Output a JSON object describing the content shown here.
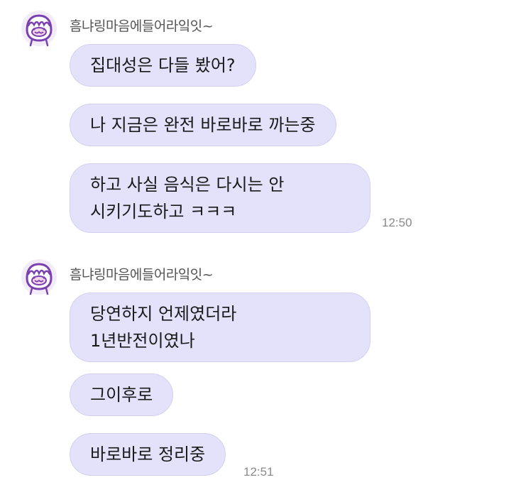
{
  "chat": {
    "groups": [
      {
        "sender": "흠냐링마음에들어라잌잇~",
        "messages": [
          {
            "lines": [
              "집대성은 다들 봤어?"
            ]
          },
          {
            "lines": [
              "나 지금은 완전 바로바로 까는중"
            ]
          },
          {
            "lines": [
              "하고 사실 음식은 다시는 안",
              "시키기도하고 ㅋㅋㅋ"
            ]
          }
        ],
        "time": "12:50"
      },
      {
        "sender": "흠냐링마음에들어라잌잇~",
        "messages": [
          {
            "lines": [
              "당연하지 언제였더라",
              "1년반전이였나"
            ]
          },
          {
            "lines": [
              "그이후로"
            ]
          },
          {
            "lines": [
              "바로바로 정리중"
            ]
          }
        ],
        "time": "12:51"
      }
    ]
  },
  "colors": {
    "bubble": "#e4e2fa",
    "bubble_border": "#d4d0f3",
    "avatar_accent": "#7a3fb0"
  },
  "icons": {
    "avatar": "purple-pudding-character-icon"
  }
}
